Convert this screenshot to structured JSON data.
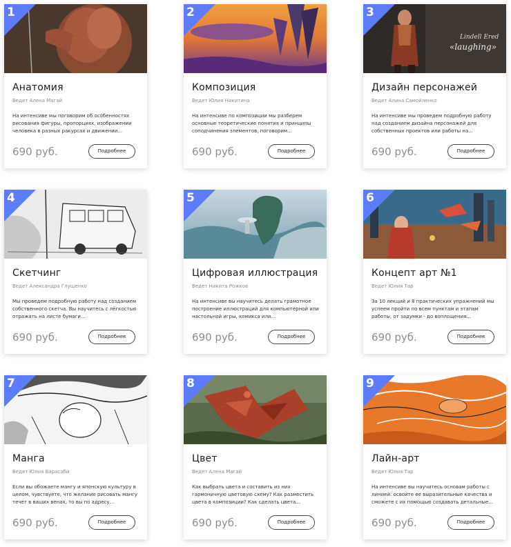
{
  "button_label": "Подробнее",
  "badge_color": "#5c7cfa",
  "courses": [
    {
      "num": "1",
      "title": "Анатомия",
      "author": "Ведет Алена Магай",
      "desc": "На интенсиве мы поговорим об особенностях рисования фигуры, пропорциях, изображении человека в разных ракурсах и движении...",
      "price": "690 руб.",
      "image": "anatomy-figure-art"
    },
    {
      "num": "2",
      "title": "Композиция",
      "author": "Ведет Юлия Никитина",
      "desc": "На интенсиве по композиции мы разберем основные теоретические понятия и принципы соподчинения элементов, поговорим...",
      "price": "690 руб.",
      "image": "composition-sky-art"
    },
    {
      "num": "3",
      "title": "Дизайн персонажей",
      "author": "Ведет Алина Самойленко",
      "desc": "На интенсиве мы проведем подробную работу над созданием дизайна персонажей для собственных проектов или работы на...",
      "price": "690 руб.",
      "image": "character-design-art"
    },
    {
      "num": "4",
      "title": "Скетчинг",
      "author": "Ведет Александра Глущенко",
      "desc": "Мы проведем подробную работу над созданием собственного скетча. Вы научитесь с лёгкостью отражать на листе бумаги...",
      "price": "690 руб.",
      "image": "sketching-bus-art"
    },
    {
      "num": "5",
      "title": "Цифровая иллюстрация",
      "author": "Ведет Никита Рожков",
      "desc": "На интенсиве вы научитесь делать грамотное построение иллюстраций для компьютерной или настольной игры, комикса или...",
      "price": "690 руб.",
      "image": "digital-landscape-art"
    },
    {
      "num": "6",
      "title": "Концепт арт №1",
      "author": "Ведет Юлия Тар",
      "desc": "За 10 лекций и 8 практических упражнений мы успеем пройти по всем пунктам и этапам работы, от задумки - до воплощения...",
      "price": "690 руб.",
      "image": "concept-city-art"
    },
    {
      "num": "7",
      "title": "Манга",
      "author": "Ведет Юлия Варасаби",
      "desc": "Если вы обожаете мангу и японскую культуру в целом, чувствуете, что желание рисовать мангу течет в ваших венах, то вы по адресу...",
      "price": "690 руб.",
      "image": "manga-sketch-art"
    },
    {
      "num": "8",
      "title": "Цвет",
      "author": "Ведет Алена Магай",
      "desc": "Как выбрать цвета и составить из них гармоничную цветовую схему? Как разместить цвета в композиции? Как сделать цвета...",
      "price": "690 руб.",
      "image": "color-dragon-art"
    },
    {
      "num": "9",
      "title": "Лайн-арт",
      "author": "Ведет Юлия Тар",
      "desc": "На интенсиве вы научитесь основам работы с линией: освоите ее выразительные качества и сможете с их помощью создавать детальные...",
      "price": "690 руб.",
      "image": "lineart-orange-art"
    }
  ]
}
